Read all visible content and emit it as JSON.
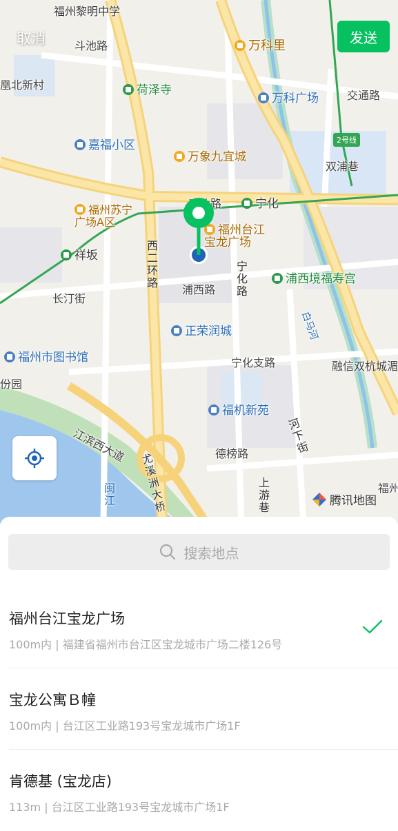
{
  "header": {
    "cancel_label": "取消",
    "send_label": "发送"
  },
  "map": {
    "attribution": "腾讯地图",
    "labels": {
      "limingzhongxue": "福州黎明中学",
      "douchilu": "斗池路",
      "wankeli": "万科里",
      "fenghuangbeixincun": "凰北新村",
      "hezesi": "荷泽寺",
      "wankeguangchang": "万科广场",
      "jiaotonglu": "交通路",
      "line2": "2号线",
      "jiafuxiaoqu": "嘉福小区",
      "wanxiangjiuyicheng": "万象九宜城",
      "shuangpuxiang": "双浦巷",
      "gongyelu": "工业路",
      "ninghua": "宁化",
      "suning": "福州苏宁\n广场A区",
      "baolong_map": "福州台江\n宝龙广场",
      "xiangban": "祥坂",
      "xierhuanlu": "西二环路",
      "ninghualu": "宁化路",
      "puxijingfushougong": "浦西境福寿宫",
      "changtingjie": "长汀街",
      "puxilu": "浦西路",
      "baimahe": "白马河",
      "zhengrongruncheng": "正荣润城",
      "library": "福州市图书馆",
      "ninghuazhilu": "宁化支路",
      "rongxin": "融信双杭城湄",
      "gongyuan": "份园",
      "fujixinyuan": "福机新苑",
      "jiangbinxidadao": "江滨西大道",
      "debanglu": "德榜路",
      "hexiajie": "河下街",
      "youxizhoudaqiao": "尤溪洲大桥",
      "minjiang": "闽江",
      "shangyouxiang": "上游巷",
      "fuzhou_edge": "福州"
    }
  },
  "search": {
    "placeholder": "搜索地点"
  },
  "results": [
    {
      "title": "福州台江宝龙广场",
      "subtitle": "100m内 | 福建省福州市台江区宝龙城市广场二楼126号",
      "selected": true
    },
    {
      "title": "宝龙公寓Ｂ幢",
      "subtitle": "100m内 | 台江区工业路193号宝龙城市广场1F",
      "selected": false
    },
    {
      "title": "肯德基 (宝龙店)",
      "subtitle": "113m | 台江区工业路193号宝龙城市广场1F",
      "selected": false
    }
  ],
  "colors": {
    "accent": "#07c160",
    "pin_blue": "#1f63b8"
  }
}
